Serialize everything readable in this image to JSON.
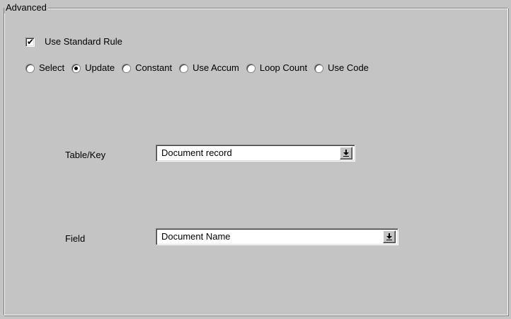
{
  "group": {
    "title": "Advanced"
  },
  "use_standard_rule": {
    "label": "Use Standard Rule",
    "checked": true
  },
  "rule_types": [
    {
      "label": "Select",
      "selected": false
    },
    {
      "label": "Update",
      "selected": true
    },
    {
      "label": "Constant",
      "selected": false
    },
    {
      "label": "Use Accum",
      "selected": false
    },
    {
      "label": "Loop Count",
      "selected": false
    },
    {
      "label": "Use Code",
      "selected": false
    }
  ],
  "table_key": {
    "label": "Table/Key",
    "value": "Document record",
    "button_icon": "dropdown-arrow-icon"
  },
  "field": {
    "label": "Field",
    "value": "Document Name",
    "button_icon": "dropdown-arrow-icon"
  }
}
